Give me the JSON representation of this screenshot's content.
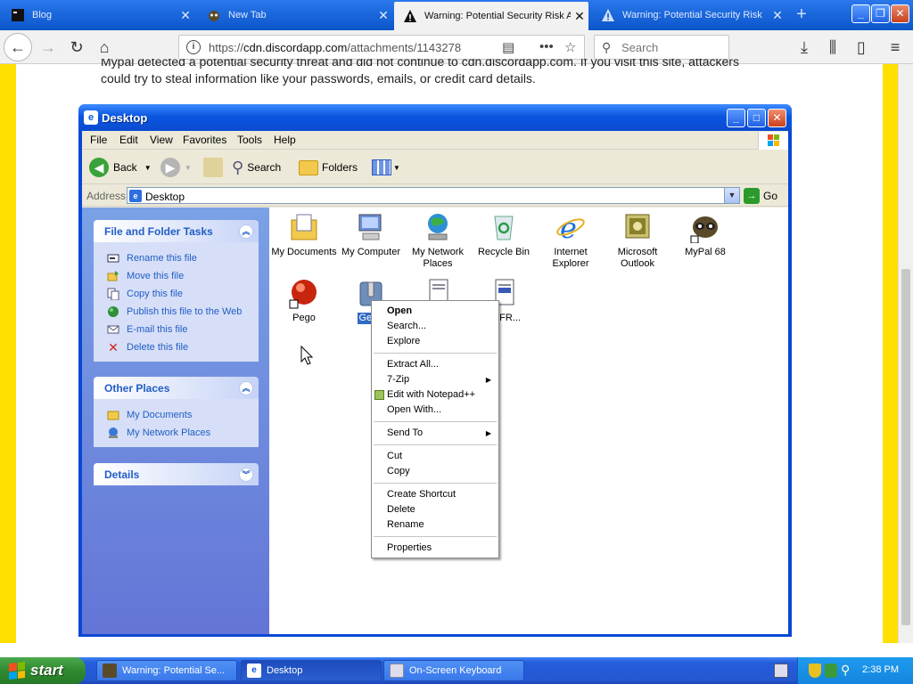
{
  "browser": {
    "tabs": [
      {
        "label": "Blog",
        "active": false
      },
      {
        "label": "New Tab",
        "active": false
      },
      {
        "label": "Warning: Potential Security Risk A",
        "active": true
      },
      {
        "label": "Warning: Potential Security Risk",
        "active": false
      }
    ],
    "close_glyph": "✕",
    "new_tab_glyph": "+",
    "url": "https://cdn.discordapp.com/attachments/1143278",
    "url_host": "cdn.discordapp.com",
    "url_prefix": "https://",
    "url_suffix": "/attachments/1143278",
    "search_placeholder": "Search"
  },
  "page": {
    "warning_text_line1": "Mypal detected a potential security threat and did not continue to cdn.discordapp.com. If you visit this site, attackers",
    "warning_text_line2": "could try to steal information like your passwords, emails, or credit card details.",
    "background_color": "#ffe000"
  },
  "explorer": {
    "title": "Desktop",
    "menus": [
      "File",
      "Edit",
      "View",
      "Favorites",
      "Tools",
      "Help"
    ],
    "toolbar": {
      "back": "Back",
      "search": "Search",
      "folders": "Folders"
    },
    "address_label": "Address",
    "address_value": "Desktop",
    "go_label": "Go",
    "panels": {
      "file_tasks": {
        "title": "File and Folder Tasks",
        "items": [
          {
            "label": "Rename this file",
            "icon": "rename-icon"
          },
          {
            "label": "Move this file",
            "icon": "move-icon"
          },
          {
            "label": "Copy this file",
            "icon": "copy-icon"
          },
          {
            "label": "Publish this file to the Web",
            "icon": "publish-icon"
          },
          {
            "label": "E-mail this file",
            "icon": "email-icon"
          },
          {
            "label": "Delete this file",
            "icon": "delete-icon"
          }
        ]
      },
      "other_places": {
        "title": "Other Places",
        "items": [
          {
            "label": "My Documents",
            "icon": "my-documents-icon"
          },
          {
            "label": "My Network Places",
            "icon": "network-places-icon"
          }
        ]
      },
      "details": {
        "title": "Details"
      }
    },
    "desktop_icons": [
      {
        "label": "My Documents",
        "icon": "my-documents-icon"
      },
      {
        "label": "My Computer",
        "icon": "my-computer-icon"
      },
      {
        "label": "My Network Places",
        "icon": "network-places-icon"
      },
      {
        "label": "Recycle Bin",
        "icon": "recycle-bin-icon"
      },
      {
        "label": "Internet Explorer",
        "icon": "internet-explorer-icon"
      },
      {
        "label": "Microsoft Outlook",
        "icon": "outlook-icon"
      },
      {
        "label": "MyPal 68",
        "icon": "mypal-icon"
      },
      {
        "label": "Pego",
        "icon": "pego-icon"
      },
      {
        "label": "Gene",
        "icon": "zip-archive-icon",
        "selected": true
      },
      {
        "label": "",
        "icon": "document-icon"
      },
      {
        "label": "ULFR...",
        "icon": "document-icon"
      }
    ],
    "context_menu": [
      {
        "label": "Open",
        "bold": true
      },
      {
        "label": "Search..."
      },
      {
        "label": "Explore"
      },
      {
        "sep": true
      },
      {
        "label": "Extract All..."
      },
      {
        "label": "7-Zip",
        "submenu": true
      },
      {
        "label": "Edit with Notepad++",
        "icon": "notepadpp-icon"
      },
      {
        "label": "Open With..."
      },
      {
        "sep": true
      },
      {
        "label": "Send To",
        "submenu": true
      },
      {
        "sep": true
      },
      {
        "label": "Cut"
      },
      {
        "label": "Copy"
      },
      {
        "sep": true
      },
      {
        "label": "Create Shortcut"
      },
      {
        "label": "Delete"
      },
      {
        "label": "Rename"
      },
      {
        "sep": true
      },
      {
        "label": "Properties"
      }
    ]
  },
  "taskbar": {
    "start_label": "start",
    "tasks": [
      {
        "label": "Warning: Potential Se...",
        "active": false
      },
      {
        "label": "Desktop",
        "active": true
      },
      {
        "label": "On-Screen Keyboard",
        "active": false
      }
    ],
    "clock": "2:38 PM"
  }
}
